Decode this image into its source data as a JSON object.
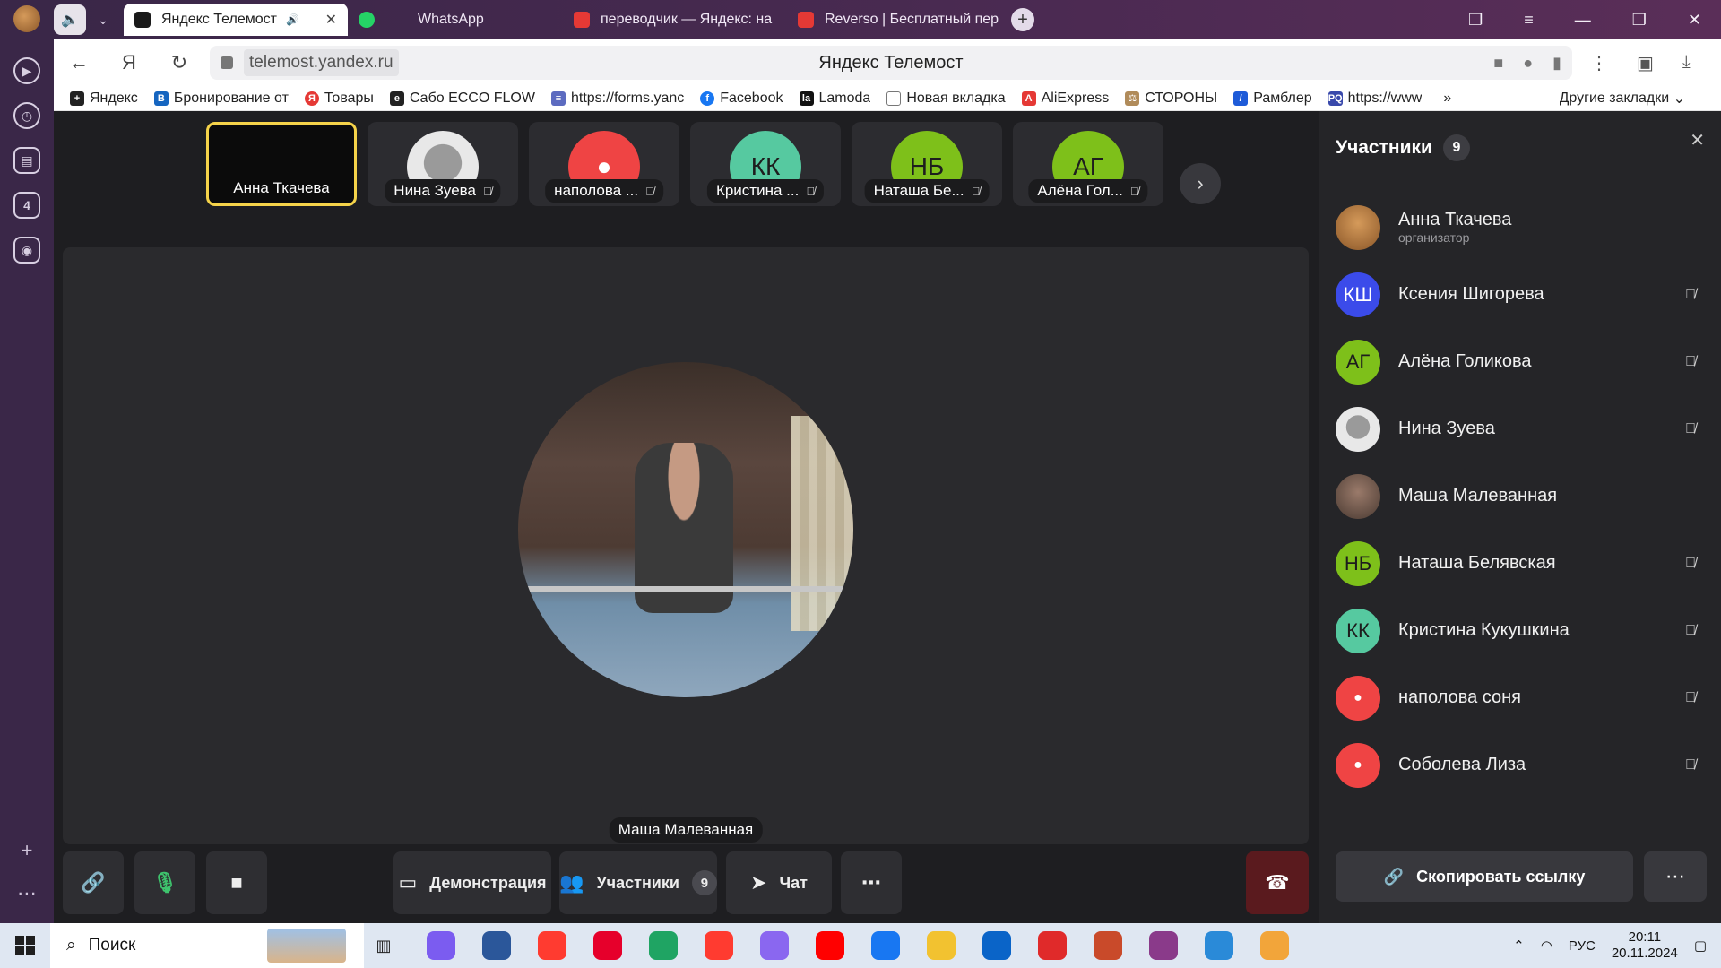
{
  "browser": {
    "tabs": [
      {
        "label": "Яндекс Телемост",
        "active": true,
        "favicon_color": "#1a1a1a",
        "sound": "🔊"
      },
      {
        "label": "WhatsApp",
        "active": false,
        "favicon_color": "#25d366"
      },
      {
        "label": "переводчик — Яндекс: на",
        "active": false,
        "favicon_color": "#e53935"
      },
      {
        "label": "Reverso | Бесплатный пер",
        "active": false,
        "favicon_color": "#e53935"
      }
    ],
    "url": "telemost.yandex.ru",
    "page_title": "Яндекс Телемост",
    "bookmarks": [
      {
        "label": "Яндекс",
        "color": "#222"
      },
      {
        "label": "Бронирование от",
        "color": "#1565c0"
      },
      {
        "label": "Товары",
        "color": "#e53935"
      },
      {
        "label": "Сабо ECCO FLOW",
        "color": "#222"
      },
      {
        "label": "https://forms.yanc",
        "color": "#5c6bc0"
      },
      {
        "label": "Facebook",
        "color": "#1877f2"
      },
      {
        "label": "Lamoda",
        "color": "#111"
      },
      {
        "label": "Новая вкладка",
        "color": "#777"
      },
      {
        "label": "AliExpress",
        "color": "#e53935"
      },
      {
        "label": "СТОРОНЫ",
        "color": "#b08b5a"
      },
      {
        "label": "Рамблер",
        "color": "#1e5bd8"
      },
      {
        "label": "https://www",
        "color": "#3949ab"
      }
    ],
    "bookmarks_more": "»",
    "other_bookmarks": "Другие закладки"
  },
  "thumbnails": [
    {
      "name": "Анна Ткачева",
      "initials": "",
      "color": "#0b0b0b",
      "speaking": true,
      "muted": false
    },
    {
      "name": "Нина Зуева",
      "initials": "",
      "color": "#e8e8e8",
      "speaking": false,
      "muted": true
    },
    {
      "name": "наполова ...",
      "initials": "",
      "color": "#ef4444",
      "speaking": false,
      "muted": true
    },
    {
      "name": "Кристина ...",
      "initials": "КК",
      "color": "#56c9a0",
      "speaking": false,
      "muted": true
    },
    {
      "name": "Наташа Бе...",
      "initials": "НБ",
      "color": "#7ec01a",
      "speaking": false,
      "muted": true
    },
    {
      "name": "Алёна Гол...",
      "initials": "АГ",
      "color": "#7ec01a",
      "speaking": false,
      "muted": true
    }
  ],
  "stage": {
    "name": "Маша Малеванная"
  },
  "controls": {
    "demo_label": "Демонстрация",
    "participants_label": "Участники",
    "participants_count": "9",
    "chat_label": "Чат"
  },
  "panel": {
    "title": "Участники",
    "count": "9",
    "participants": [
      {
        "name": "Анна Ткачева",
        "role": "организатор",
        "initials": "",
        "color": "#c58a4f",
        "muted": false
      },
      {
        "name": "Ксения Шигорева",
        "role": "",
        "initials": "КШ",
        "color": "#3b4bea",
        "muted": true
      },
      {
        "name": "Алёна Голикова",
        "role": "",
        "initials": "АГ",
        "color": "#7ec01a",
        "muted": true
      },
      {
        "name": "Нина Зуева",
        "role": "",
        "initials": "",
        "color": "#e8e8e8",
        "muted": true
      },
      {
        "name": "Маша Малеванная",
        "role": "",
        "initials": "",
        "color": "#6a5a50",
        "muted": false
      },
      {
        "name": "Наташа Белявская",
        "role": "",
        "initials": "НБ",
        "color": "#7ec01a",
        "muted": true
      },
      {
        "name": "Кристина Кукушкина",
        "role": "",
        "initials": "КК",
        "color": "#56c9a0",
        "muted": true
      },
      {
        "name": "наполова соня",
        "role": "",
        "initials": "",
        "color": "#ef4444",
        "muted": true
      },
      {
        "name": "Соболева Лиза",
        "role": "",
        "initials": "",
        "color": "#ef4444",
        "muted": true
      }
    ],
    "copy_link_label": "Скопировать ссылку"
  },
  "taskbar": {
    "search_label": "Поиск",
    "lang": "РУС",
    "time": "20:11",
    "date": "20.11.2024",
    "apps": [
      {
        "icon": "alice-icon",
        "color": "#7b5cf0"
      },
      {
        "icon": "word-icon",
        "color": "#2b579a"
      },
      {
        "icon": "yandex-browser-icon",
        "color": "#ff3b30"
      },
      {
        "icon": "opera-icon",
        "color": "#e6002b"
      },
      {
        "icon": "edge-icon",
        "color": "#1fa463"
      },
      {
        "icon": "yandex-icon",
        "color": "#ff3b30"
      },
      {
        "icon": "copilot-icon",
        "color": "#8a67f0"
      },
      {
        "icon": "youtube-icon",
        "color": "#ff0000"
      },
      {
        "icon": "facebook-icon",
        "color": "#1877f2"
      },
      {
        "icon": "explorer-icon",
        "color": "#f2c230"
      },
      {
        "icon": "outlook-icon",
        "color": "#0a64c8"
      },
      {
        "icon": "wps-icon",
        "color": "#e02a2a"
      },
      {
        "icon": "pdf-icon",
        "color": "#c94a2a"
      },
      {
        "icon": "winrar-icon",
        "color": "#8a3a8a"
      },
      {
        "icon": "paint-icon",
        "color": "#2a8ad8"
      },
      {
        "icon": "music-icon",
        "color": "#f2a53a"
      }
    ]
  }
}
